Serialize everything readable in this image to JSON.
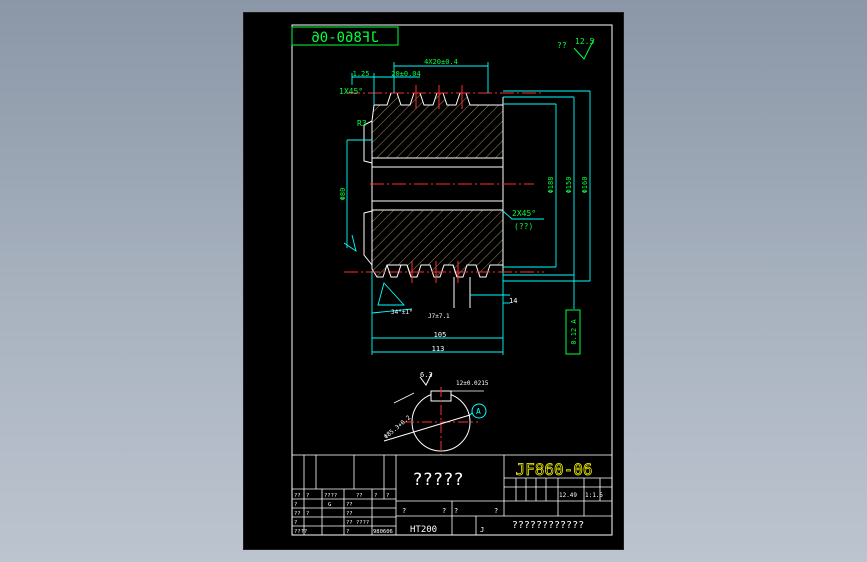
{
  "drawing": {
    "header_code": "JF860-06",
    "roughness_label": "??",
    "roughness_value": "12.5",
    "dim_top_width": "4X20±0.4",
    "dim_chamfer_left": "1.25",
    "dim_tooth_width": "20±0.04",
    "chamfer_top": "1X45°",
    "radius_label": "R3",
    "dim_bore": "Φ80",
    "dim_d188": "Φ188",
    "dim_d150": "Φ150",
    "dim_d160": "Φ160",
    "chamfer_right": "2X45°",
    "chamfer_right_note": "(??)",
    "tolerance_frame": "0.12 A",
    "dim_angle": "34°±1°",
    "dim_depth": "J7±7.1",
    "dim_slot": "14",
    "dim_width_inner": "105",
    "dim_width_total": "113",
    "keyway_roughness": "6.3",
    "keyway_width": "12±0.0215",
    "keyway_depth": "Φ85.3+0.2",
    "datum_label": "A"
  },
  "title_block": {
    "drawing_number": "JF860-06",
    "part_name": "?????",
    "material": "HT200",
    "scale_col1": "12.49",
    "scale_col2": "1:1.5",
    "company": "????????????",
    "sheet_mark": "J",
    "left_cells": [
      "??",
      "?",
      "????",
      "??",
      "?",
      "?",
      "?",
      "G",
      "??",
      "??",
      "?",
      "??",
      "?",
      "??",
      "????",
      "?",
      "????",
      "980606"
    ],
    "mid_marks": [
      "?",
      "?",
      "?",
      "?"
    ]
  },
  "colors": {
    "sheet_bg": "#000000",
    "border": "#ffffff",
    "text": "#f0f0f0",
    "dimension": "#00ffff",
    "outline": "#ffffff",
    "centerline": "#ff2b2b",
    "green": "#00ff3c",
    "hatch": "#c8b26a",
    "yellow": "#ffff00"
  }
}
